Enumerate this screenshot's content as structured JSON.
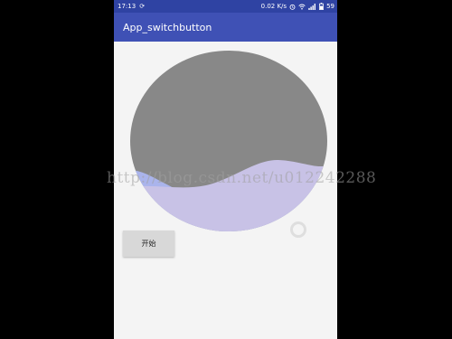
{
  "status_bar": {
    "time": "17:13",
    "speed": "0.02 K/s",
    "battery": "59",
    "icons": [
      "sync-icon",
      "alarm-icon",
      "wifi-icon",
      "signal-icon",
      "battery-icon"
    ]
  },
  "app_bar": {
    "title": "App_switchbutton"
  },
  "wave": {
    "circle_color": "#888888",
    "wave_front_color": "#c8c2e6",
    "wave_back_color": "#aab4ec"
  },
  "start_button": {
    "label": "开始"
  },
  "watermark": {
    "text": "http://blog.csdn.net/u012242288"
  },
  "colors": {
    "primary": "#3f51b5",
    "primary_dark": "#2f43a3",
    "background": "#f4f4f4"
  }
}
